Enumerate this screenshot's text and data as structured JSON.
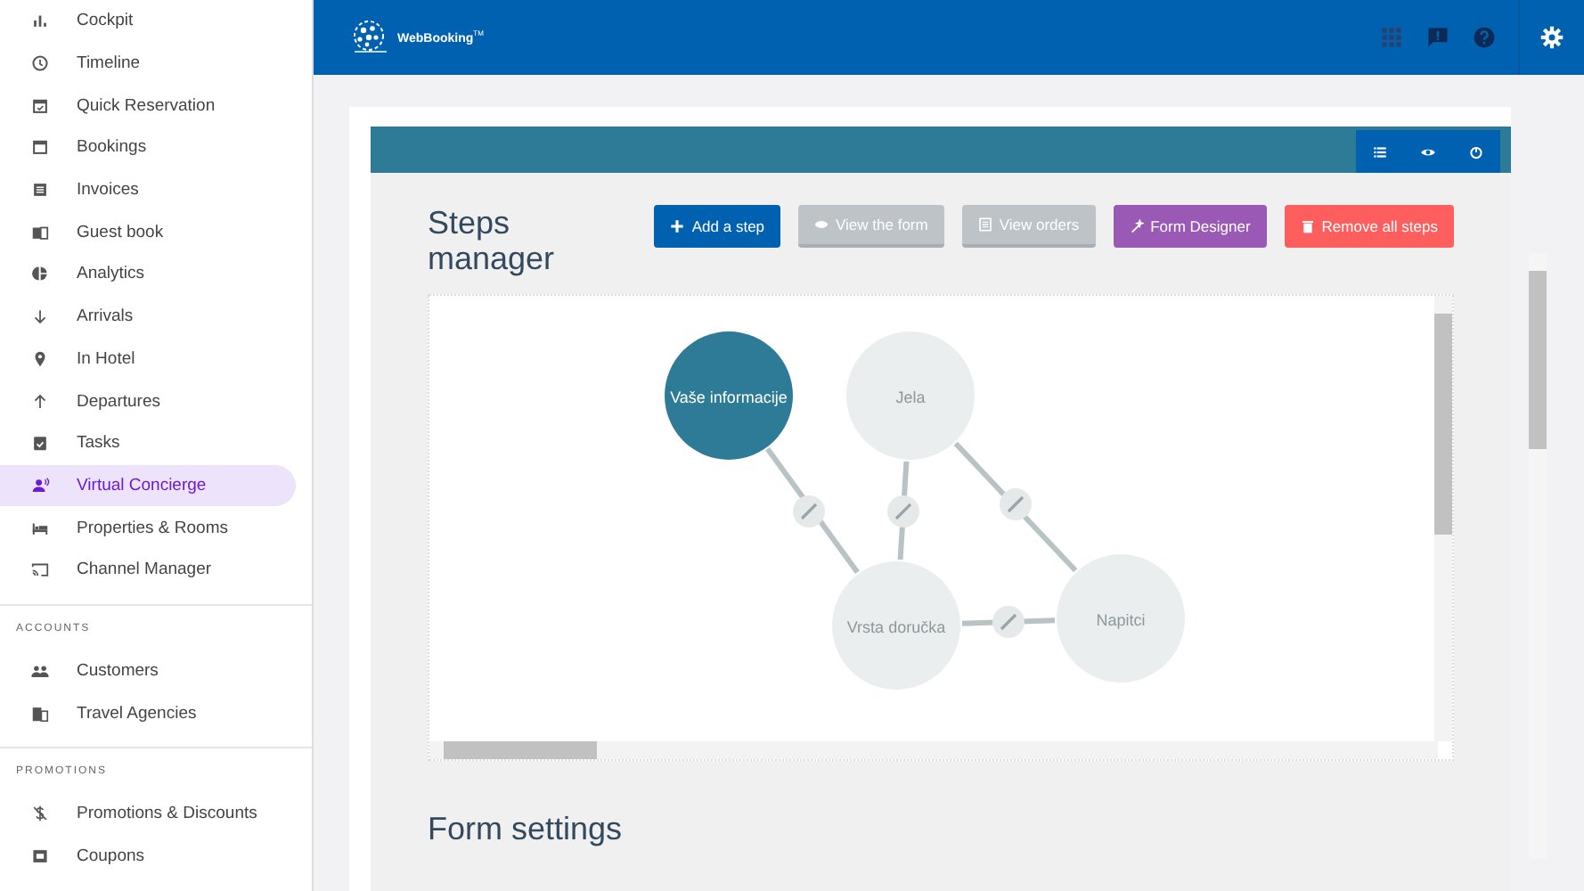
{
  "sidebar": {
    "sections": [
      {
        "items": [
          {
            "label": "Cockpit",
            "kind": "bars",
            "selected": false
          },
          {
            "label": "Timeline",
            "kind": "clock",
            "selected": false
          },
          {
            "label": "Quick Reservation",
            "kind": "calcheck",
            "selected": false
          },
          {
            "label": "Bookings",
            "kind": "cal",
            "selected": false
          },
          {
            "label": "Invoices",
            "kind": "list",
            "selected": false
          },
          {
            "label": "Guest book",
            "kind": "book",
            "selected": false
          },
          {
            "label": "Analytics",
            "kind": "pie",
            "selected": false
          },
          {
            "label": "Arrivals",
            "kind": "down",
            "selected": false
          },
          {
            "label": "In Hotel",
            "kind": "pin",
            "selected": false
          },
          {
            "label": "Departures",
            "kind": "up",
            "selected": false
          },
          {
            "label": "Tasks",
            "kind": "task",
            "selected": false
          },
          {
            "label": "Virtual Concierge",
            "kind": "person",
            "selected": true
          },
          {
            "label": "Properties & Rooms",
            "kind": "bed",
            "selected": false
          },
          {
            "label": "Channel Manager",
            "kind": "cast",
            "selected": false
          }
        ]
      },
      {
        "title": "ACCOUNTS",
        "items": [
          {
            "label": "Customers",
            "kind": "people",
            "selected": false
          },
          {
            "label": "Travel Agencies",
            "kind": "building",
            "selected": false
          }
        ]
      },
      {
        "title": "PROMOTIONS",
        "items": [
          {
            "label": "Promotions & Discounts",
            "kind": "dollar",
            "selected": false
          },
          {
            "label": "Coupons",
            "kind": "coupon",
            "selected": false
          }
        ]
      }
    ]
  },
  "topbar": {
    "logo": "WebBooking",
    "logo_mark": "TM"
  },
  "panel": {
    "title": "Steps manager",
    "buttons": [
      {
        "label": "Add a step",
        "kind": "add"
      },
      {
        "label": "View the form",
        "kind": "view"
      },
      {
        "label": "View orders",
        "kind": "orders"
      },
      {
        "label": "Form Designer",
        "kind": "designer"
      },
      {
        "label": "Remove all steps",
        "kind": "remove"
      }
    ],
    "nodes": [
      {
        "label": "Vaše informacije",
        "selected": true
      },
      {
        "label": "Jela",
        "selected": false
      },
      {
        "label": "Vrsta doručka",
        "selected": false
      },
      {
        "label": "Napitci",
        "selected": false
      }
    ],
    "section_title": "Form settings"
  }
}
